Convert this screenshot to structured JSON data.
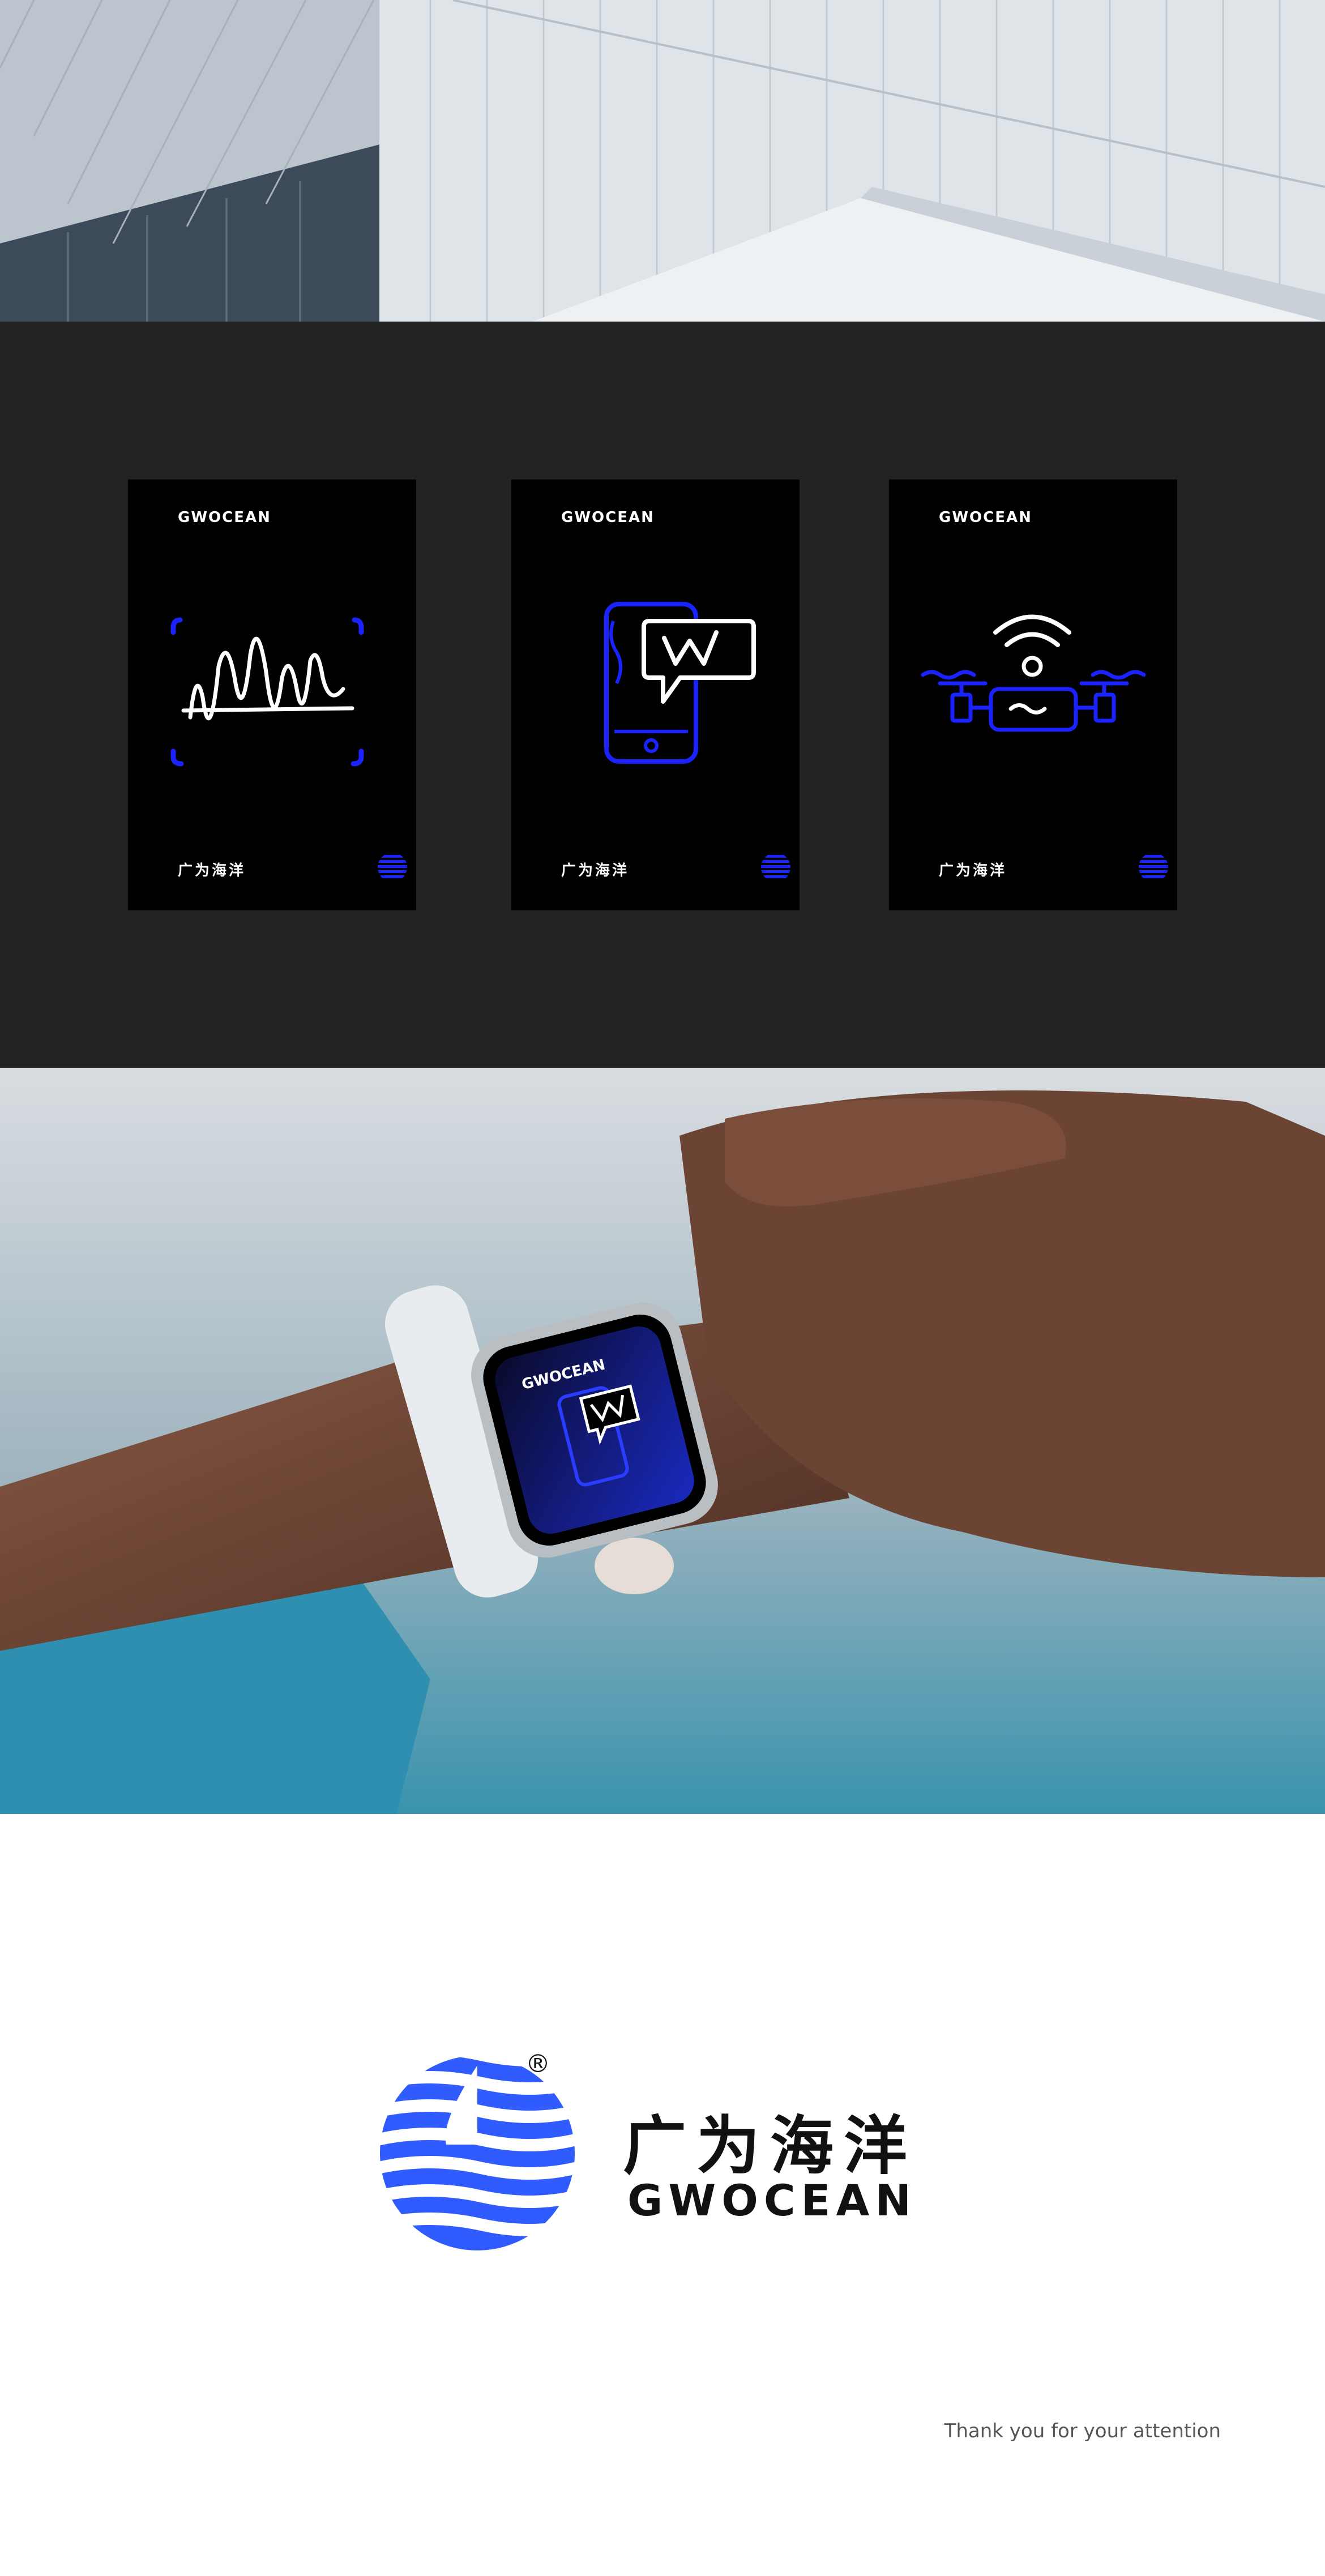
{
  "brand": {
    "name_en": "GWOCEAN",
    "name_cn": "广为海洋",
    "registered_mark": "®",
    "primary_color": "#2f5bff",
    "icon_blue": "#1a22ff"
  },
  "cards": [
    {
      "brand": "GWOCEAN",
      "cn": "广为海洋",
      "icon": "waveform-scan-icon"
    },
    {
      "brand": "GWOCEAN",
      "cn": "广为海洋",
      "icon": "phone-chat-icon"
    },
    {
      "brand": "GWOCEAN",
      "cn": "广为海洋",
      "icon": "drone-wifi-icon"
    }
  ],
  "watch": {
    "brand": "GWOCEAN",
    "icon": "phone-chat-icon"
  },
  "footer": {
    "thanks": "Thank you for your attention"
  }
}
